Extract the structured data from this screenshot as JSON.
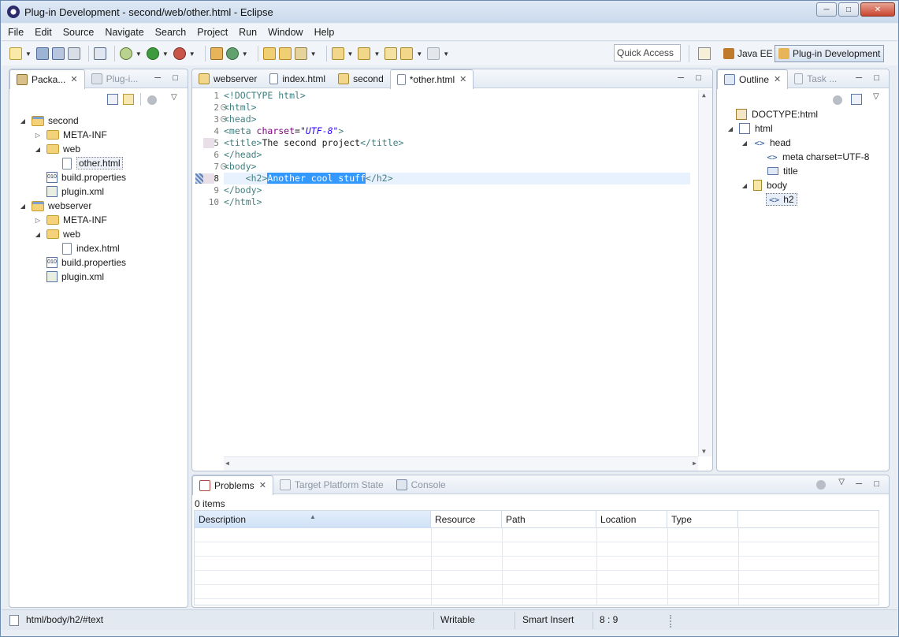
{
  "window": {
    "title": "Plug-in Development - second/web/other.html - Eclipse",
    "controls": [
      "minimize",
      "maximize",
      "close"
    ]
  },
  "menubar": [
    "File",
    "Edit",
    "Source",
    "Navigate",
    "Search",
    "Project",
    "Run",
    "Window",
    "Help"
  ],
  "toolbar": {
    "quick_access": "Quick Access",
    "perspectives": [
      "Java EE",
      "Plug-in Development"
    ],
    "active_perspective": "Plug-in Development"
  },
  "left_panel": {
    "tabs": [
      {
        "label": "Packa...",
        "active": true
      },
      {
        "label": "Plug-i...",
        "active": false
      }
    ],
    "tree": [
      {
        "label": "second",
        "kind": "project",
        "level": 0,
        "twisty": "expanded"
      },
      {
        "label": "META-INF",
        "kind": "folder",
        "level": 1,
        "twisty": "collapsed"
      },
      {
        "label": "web",
        "kind": "folder",
        "level": 1,
        "twisty": "expanded"
      },
      {
        "label": "other.html",
        "kind": "file",
        "level": 2,
        "twisty": "none",
        "selected": true
      },
      {
        "label": "build.properties",
        "kind": "props",
        "level": 1,
        "twisty": "none"
      },
      {
        "label": "plugin.xml",
        "kind": "plugin",
        "level": 1,
        "twisty": "none"
      },
      {
        "label": "webserver",
        "kind": "project",
        "level": 0,
        "twisty": "expanded"
      },
      {
        "label": "META-INF",
        "kind": "folder",
        "level": 1,
        "twisty": "collapsed"
      },
      {
        "label": "web",
        "kind": "folder",
        "level": 1,
        "twisty": "expanded"
      },
      {
        "label": "index.html",
        "kind": "file",
        "level": 2,
        "twisty": "none"
      },
      {
        "label": "build.properties",
        "kind": "props",
        "level": 1,
        "twisty": "none"
      },
      {
        "label": "plugin.xml",
        "kind": "plugin",
        "level": 1,
        "twisty": "none"
      }
    ]
  },
  "editor": {
    "tabs": [
      {
        "label": "webserver",
        "active": false
      },
      {
        "label": "index.html",
        "active": false
      },
      {
        "label": "second",
        "active": false
      },
      {
        "label": "*other.html",
        "active": true
      }
    ],
    "line_numbers": [
      "1",
      "2",
      "3",
      "4",
      "5",
      "6",
      "7",
      "8",
      "9",
      "10"
    ],
    "lines": [
      {
        "parts": [
          {
            "t": "<!DOCTYPE html>",
            "c": "doctype"
          }
        ]
      },
      {
        "parts": [
          {
            "t": "<html>",
            "c": "tag"
          }
        ]
      },
      {
        "parts": [
          {
            "t": "<head>",
            "c": "tag"
          }
        ]
      },
      {
        "parts": [
          {
            "t": "<meta ",
            "c": "tag"
          },
          {
            "t": "charset",
            "c": "attr"
          },
          {
            "t": "=",
            "c": ""
          },
          {
            "t": "\"UTF-8\"",
            "c": "val"
          },
          {
            "t": ">",
            "c": "tag"
          }
        ]
      },
      {
        "parts": [
          {
            "t": "<title>",
            "c": "tag"
          },
          {
            "t": "The second project",
            "c": ""
          },
          {
            "t": "</title>",
            "c": "tag"
          }
        ]
      },
      {
        "parts": [
          {
            "t": "</head>",
            "c": "tag"
          }
        ]
      },
      {
        "parts": [
          {
            "t": "<body>",
            "c": "tag"
          }
        ]
      },
      {
        "parts": [
          {
            "t": "    ",
            "c": ""
          },
          {
            "t": "<h2>",
            "c": "tag"
          },
          {
            "t": "Another cool stuff",
            "c": "sel"
          },
          {
            "t": "</h2>",
            "c": "tag"
          }
        ]
      },
      {
        "parts": [
          {
            "t": "</body>",
            "c": "tag"
          }
        ]
      },
      {
        "parts": [
          {
            "t": "</html>",
            "c": "tag"
          }
        ]
      }
    ],
    "current_line": 8
  },
  "outline": {
    "tabs": [
      {
        "label": "Outline",
        "active": true
      },
      {
        "label": "Task ...",
        "active": false
      }
    ],
    "tree": [
      {
        "label": "DOCTYPE:html",
        "level": 0,
        "twisty": "none",
        "kind": "doctype"
      },
      {
        "label": "html",
        "level": 0,
        "twisty": "expanded",
        "kind": "html"
      },
      {
        "label": "head",
        "level": 1,
        "twisty": "expanded",
        "kind": "element"
      },
      {
        "label": "meta charset=UTF-8",
        "level": 2,
        "twisty": "none",
        "kind": "element"
      },
      {
        "label": "title",
        "level": 2,
        "twisty": "none",
        "kind": "title"
      },
      {
        "label": "body",
        "level": 1,
        "twisty": "expanded",
        "kind": "body"
      },
      {
        "label": "h2",
        "level": 2,
        "twisty": "none",
        "kind": "element",
        "selected": true
      }
    ]
  },
  "problems": {
    "tabs": [
      {
        "label": "Problems",
        "active": true
      },
      {
        "label": "Target Platform State",
        "active": false
      },
      {
        "label": "Console",
        "active": false
      }
    ],
    "count_label": "0 items",
    "columns": [
      "Description",
      "Resource",
      "Path",
      "Location",
      "Type"
    ]
  },
  "statusbar": {
    "path": "html/body/h2/#text",
    "writable": "Writable",
    "insert_mode": "Smart Insert",
    "position": "8 : 9"
  },
  "colors": {
    "selection": "#3399ff",
    "current_line": "#e8f2fe",
    "tag": "#3f7f7f",
    "attr": "#7f007f",
    "value": "#2a00ff"
  }
}
